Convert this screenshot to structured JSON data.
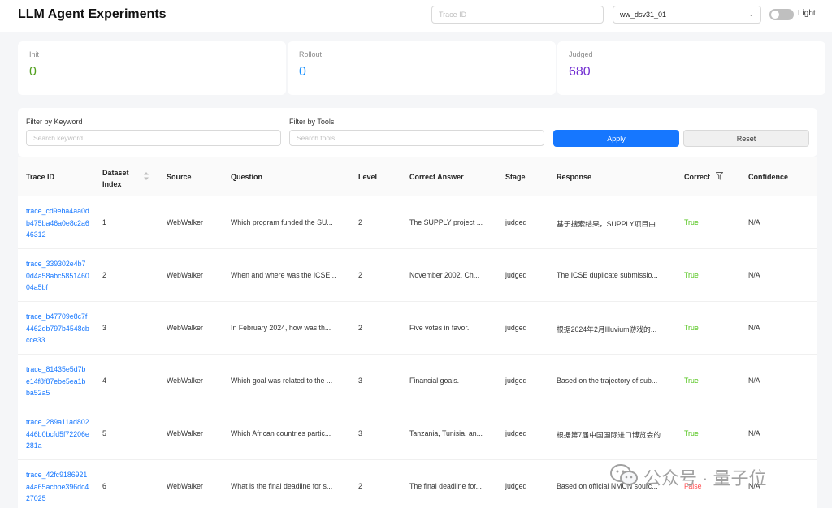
{
  "header": {
    "title": "LLM Agent Experiments",
    "trace_placeholder": "Trace ID",
    "dataset_select": "ww_dsv31_01",
    "theme_label": "Light"
  },
  "stats": [
    {
      "label": "Init",
      "value": "0",
      "color": "#52a01f"
    },
    {
      "label": "Rollout",
      "value": "0",
      "color": "#1890ff"
    },
    {
      "label": "Judged",
      "value": "680",
      "color": "#722ed1"
    }
  ],
  "filters": {
    "keyword_label": "Filter by Keyword",
    "keyword_placeholder": "Search keyword...",
    "tools_label": "Filter by Tools",
    "tools_placeholder": "Search tools...",
    "apply_label": "Apply",
    "reset_label": "Reset"
  },
  "table": {
    "columns": {
      "trace_id": "Trace ID",
      "dataset_index": "Dataset Index",
      "source": "Source",
      "question": "Question",
      "level": "Level",
      "correct_answer": "Correct Answer",
      "stage": "Stage",
      "response": "Response",
      "correct": "Correct",
      "confidence": "Confidence"
    },
    "rows": [
      {
        "trace_id": "trace_cd9eba4aa0db475ba46a0e8c2a646312",
        "index": "1",
        "source": "WebWalker",
        "question": "Which program funded the SU...",
        "level": "2",
        "answer": "The SUPPLY project ...",
        "stage": "judged",
        "response": "基于搜索结果，SUPPLY项目由...",
        "correct": "True",
        "confidence": "N/A"
      },
      {
        "trace_id": "trace_339302e4b70d4a58abc585146004a5bf",
        "index": "2",
        "source": "WebWalker",
        "question": "When and where was the ICSE...",
        "level": "2",
        "answer": "November 2002, Ch...",
        "stage": "judged",
        "response": "The ICSE duplicate submissio...",
        "correct": "True",
        "confidence": "N/A"
      },
      {
        "trace_id": "trace_b47709e8c7f4462db797b4548cbcce33",
        "index": "3",
        "source": "WebWalker",
        "question": "In February 2024, how was th...",
        "level": "2",
        "answer": "Five votes in favor.",
        "stage": "judged",
        "response": "根据2024年2月Illuvium游戏的...",
        "correct": "True",
        "confidence": "N/A"
      },
      {
        "trace_id": "trace_81435e5d7be14f8f87ebe5ea1bba52a5",
        "index": "4",
        "source": "WebWalker",
        "question": "Which goal was related to the ...",
        "level": "3",
        "answer": "Financial goals.",
        "stage": "judged",
        "response": "Based on the trajectory of sub...",
        "correct": "True",
        "confidence": "N/A"
      },
      {
        "trace_id": "trace_289a11ad802446b0bcfd5f72206e281a",
        "index": "5",
        "source": "WebWalker",
        "question": "Which African countries partic...",
        "level": "3",
        "answer": "Tanzania, Tunisia, an...",
        "stage": "judged",
        "response": "根据第7届中国国际进口博览会的...",
        "correct": "True",
        "confidence": "N/A"
      },
      {
        "trace_id": "trace_42fc9186921a4a65acbbe396dc427025",
        "index": "6",
        "source": "WebWalker",
        "question": "What is the final deadline for s...",
        "level": "2",
        "answer": "The final deadline for...",
        "stage": "judged",
        "response": "Based on official NMUN sourc...",
        "correct": "False",
        "confidence": "N/A"
      }
    ]
  },
  "watermark": {
    "text": "公众号 · 量子位"
  },
  "colors": {
    "accent": "#1677ff",
    "true": "#52c41a",
    "false": "#ff4d4f"
  }
}
